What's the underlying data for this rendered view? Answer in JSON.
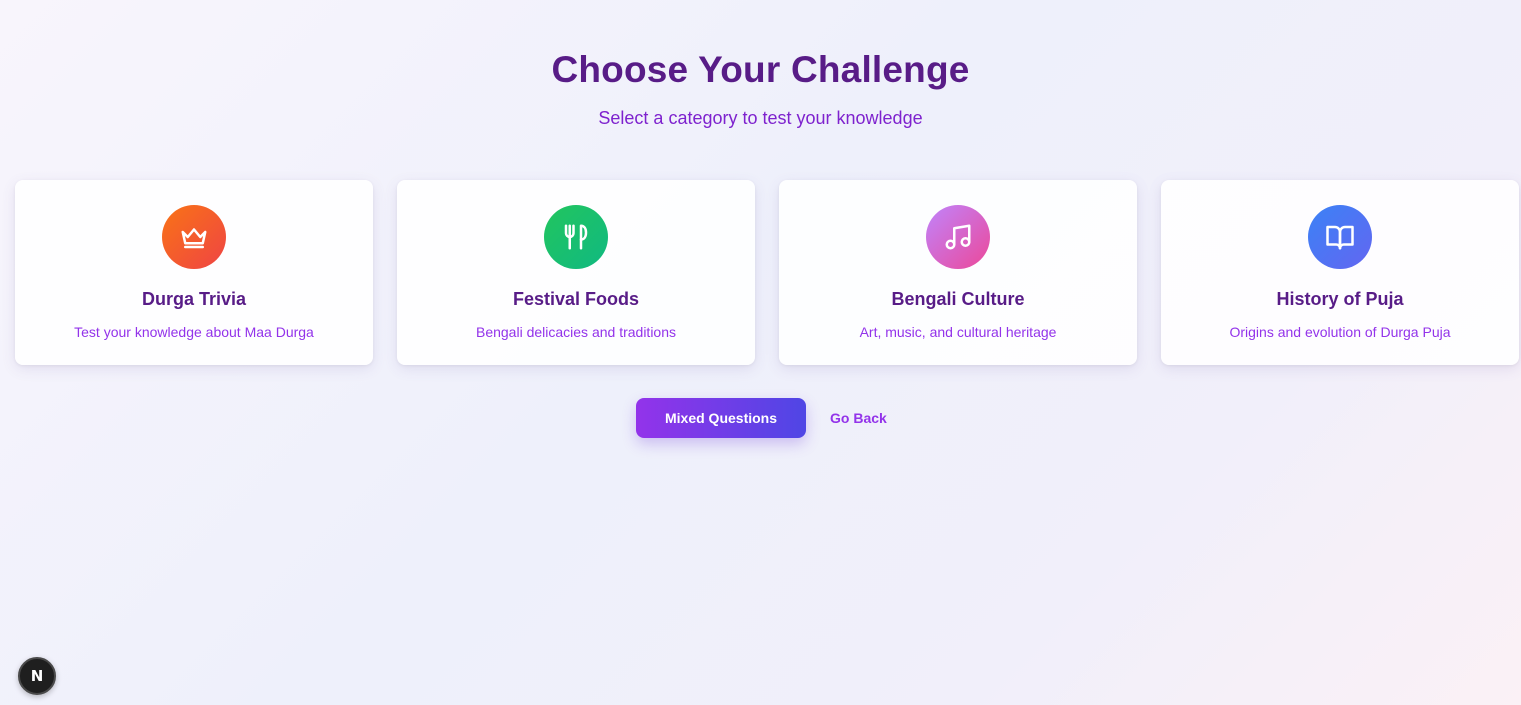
{
  "header": {
    "title": "Choose Your Challenge",
    "subtitle": "Select a category to test your knowledge"
  },
  "categories": [
    {
      "title": "Durga Trivia",
      "description": "Test your knowledge about Maa Durga",
      "icon": "crown-icon",
      "gradient": [
        "#f97316",
        "#ef4444"
      ]
    },
    {
      "title": "Festival Foods",
      "description": "Bengali delicacies and traditions",
      "icon": "utensils-icon",
      "gradient": [
        "#22c55e",
        "#10b981"
      ]
    },
    {
      "title": "Bengali Culture",
      "description": "Art, music, and cultural heritage",
      "icon": "music-icon",
      "gradient": [
        "#c084fc",
        "#ec4899"
      ]
    },
    {
      "title": "History of Puja",
      "description": "Origins and evolution of Durga Puja",
      "icon": "book-icon",
      "gradient": [
        "#3b82f6",
        "#6366f1"
      ]
    }
  ],
  "actions": {
    "mixed_label": "Mixed Questions",
    "back_label": "Go Back"
  },
  "dev_badge": {
    "label": "N"
  },
  "colors": {
    "title": "#581c87",
    "accent": "#9333ea",
    "button_gradient": [
      "#9333ea",
      "#4f46e5"
    ]
  }
}
